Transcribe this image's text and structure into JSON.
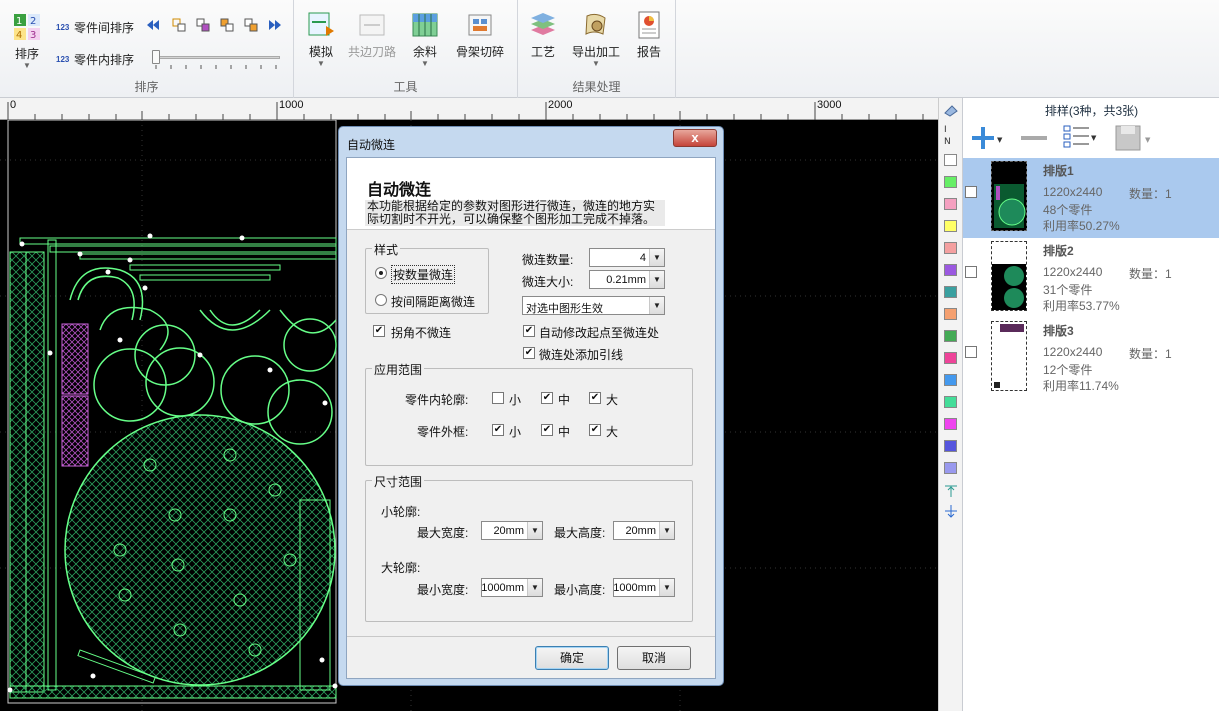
{
  "ribbon": {
    "groups": {
      "sort": {
        "label": "排序",
        "sort_button": "排序",
        "between_parts_sort": "零件间排序",
        "within_part_sort": "零件内排序"
      },
      "tools": {
        "label": "工具",
        "simulate": "模拟",
        "common_edge": "共边刀路",
        "remnant": "余料",
        "skeleton_cut": "骨架切碎"
      },
      "result": {
        "label": "结果处理",
        "process": "工艺",
        "export": "导出加工",
        "report": "报告"
      }
    }
  },
  "ruler": {
    "ticks": [
      "0",
      "1000",
      "2000",
      "3000"
    ]
  },
  "panel": {
    "header": "排样(3种，共3张)",
    "sheets": [
      {
        "name": "排版1",
        "size": "1220x2440",
        "qty": "数量：1",
        "parts": "48个零件",
        "util": "利用率50.27%",
        "selected": true
      },
      {
        "name": "排版2",
        "size": "1220x2440",
        "qty": "数量：1",
        "parts": "31个零件",
        "util": "利用率53.77%",
        "selected": false
      },
      {
        "name": "排版3",
        "size": "1220x2440",
        "qty": "数量：1",
        "parts": "12个零件",
        "util": "利用率11.74%",
        "selected": false
      }
    ]
  },
  "swatches": [
    "#ffffff",
    "#66ee66",
    "#f4a0c0",
    "#ffff66",
    "#f4a0a0",
    "#9b59e0",
    "#3aa0a0",
    "#f4a070",
    "#44aa55",
    "#ee4499",
    "#4499ee",
    "#44dd99",
    "#ee44ee",
    "#5555dd",
    "#9999ee"
  ],
  "dialog": {
    "title": "自动微连",
    "close": "x",
    "heading": "自动微连",
    "description": "本功能根据给定的参数对图形进行微连，微连的地方实际切割时不开光，可以确保整个图形加工完成不掉落。",
    "style": {
      "legend": "样式",
      "by_count": "按数量微连",
      "by_interval": "按间隔距离微连",
      "by_count_selected": true
    },
    "corner_no_joint": "拐角不微连",
    "joint_count_label": "微连数量:",
    "joint_count": "4",
    "joint_size_label": "微连大小:",
    "joint_size": "0.21mm",
    "apply_mode": "对选中图形生效",
    "auto_start": "自动修改起点至微连处",
    "add_lead": "微连处添加引线",
    "scope": {
      "legend": "应用范围",
      "inner_label": "零件内轮廓:",
      "outer_label": "零件外框:",
      "small": "小",
      "medium": "中",
      "large": "大",
      "inner": [
        false,
        true,
        true
      ],
      "outer": [
        true,
        true,
        true
      ]
    },
    "size_range": {
      "legend": "尺寸范围",
      "small_contour": "小轮廓:",
      "max_width_label": "最大宽度:",
      "max_width": "20mm",
      "max_height_label": "最大高度:",
      "max_height": "20mm",
      "large_contour": "大轮廓:",
      "min_width_label": "最小宽度:",
      "min_width": "1000mm",
      "min_height_label": "最小高度:",
      "min_height": "1000mm"
    },
    "ok": "确定",
    "cancel": "取消"
  }
}
